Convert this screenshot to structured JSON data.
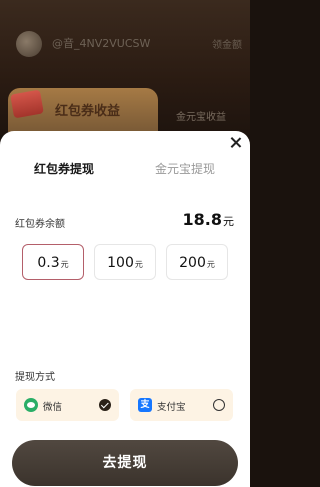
{
  "background": {
    "username": "@音_4NV2VUCSW",
    "right_link": "领金额",
    "active_tab": "红包券收益",
    "inactive_tab": "金元宝收益"
  },
  "sheet": {
    "tabs": [
      {
        "label": "红包券提现",
        "active": true
      },
      {
        "label": "金元宝提现",
        "active": false
      }
    ],
    "balance": {
      "label": "红包券余额",
      "value": "18.8",
      "unit": "元"
    },
    "amounts": [
      {
        "value": "0.3",
        "unit": "元",
        "selected": true
      },
      {
        "value": "100",
        "unit": "元",
        "selected": false
      },
      {
        "value": "200",
        "unit": "元",
        "selected": false
      }
    ],
    "method_title": "提现方式",
    "methods": [
      {
        "label": "微信",
        "icon": "wechat-icon",
        "checked": true
      },
      {
        "label": "支付宝",
        "icon": "alipay-icon",
        "checked": false
      }
    ],
    "alipay_glyph": "支",
    "submit_label": "去提现"
  },
  "colors": {
    "accent_selected": "#b45f6a",
    "method_bg": "#fdf3e4",
    "submit_bg": "#3b332c"
  }
}
